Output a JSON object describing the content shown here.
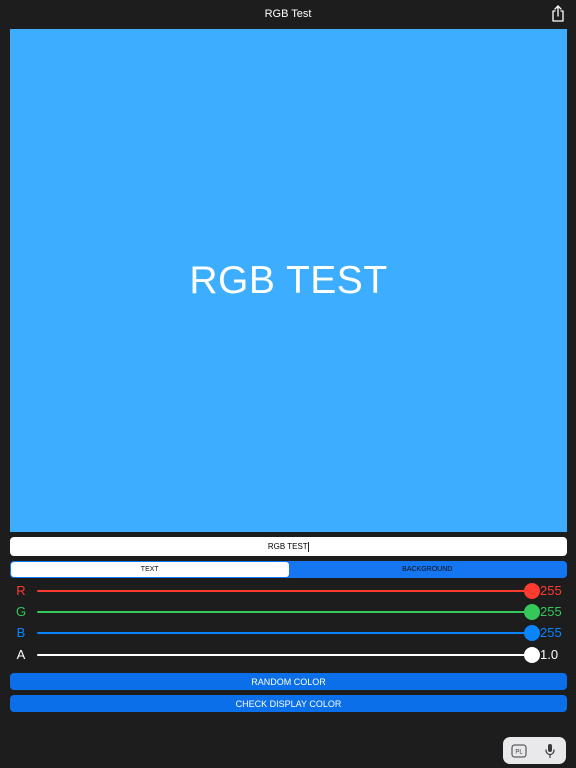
{
  "nav": {
    "title": "RGB Test",
    "share_icon": "share-icon"
  },
  "preview": {
    "text": "RGB TEST",
    "background_color": "#3daeff",
    "text_color": "#ffffff"
  },
  "text_field": {
    "value": "RGB TEST"
  },
  "segments": {
    "text_label": "TEXT",
    "background_label": "BACKGROUND",
    "selected": "TEXT"
  },
  "sliders": [
    {
      "label": "R",
      "value": "255",
      "fraction": 1.0,
      "color": "#ff3b30"
    },
    {
      "label": "G",
      "value": "255",
      "fraction": 1.0,
      "color": "#34c759"
    },
    {
      "label": "B",
      "value": "255",
      "fraction": 1.0,
      "color": "#0a84ff"
    },
    {
      "label": "A",
      "value": "1.0",
      "fraction": 1.0,
      "color": "#ffffff"
    }
  ],
  "buttons": {
    "random_color": "RANDOM COLOR",
    "check_display_color": "CHECK DISPLAY COLOR"
  },
  "keyboard_bar": {
    "language": "PL",
    "mic_icon": "microphone-icon"
  },
  "colors": {
    "accent": "#0a6fe8",
    "app_background": "#1d1d1d"
  }
}
